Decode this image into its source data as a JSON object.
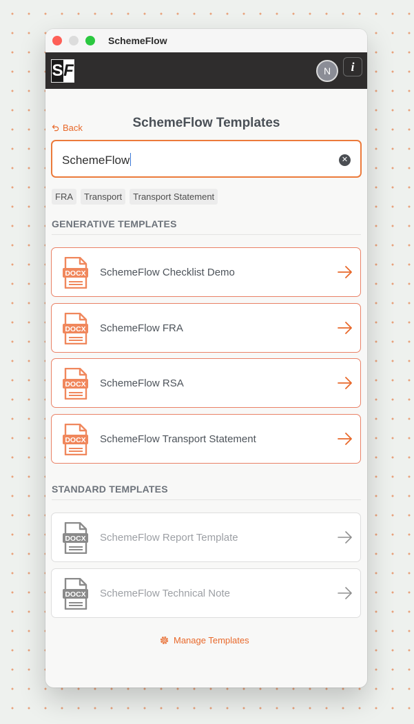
{
  "window": {
    "title": "SchemeFlow"
  },
  "appbar": {
    "logo_left": "S",
    "logo_right": "F",
    "avatar_initial": "N",
    "info_label": "i"
  },
  "nav": {
    "back_label": "Back"
  },
  "page": {
    "title": "SchemeFlow Templates"
  },
  "search": {
    "value": "SchemeFlow",
    "clear_icon": "clear-circle-icon"
  },
  "filters": [
    "FRA",
    "Transport",
    "Transport Statement"
  ],
  "generative": {
    "heading": "GENERATIVE TEMPLATES",
    "items": [
      {
        "label": "SchemeFlow Checklist Demo",
        "icon_text": "DOCX"
      },
      {
        "label": "SchemeFlow FRA",
        "icon_text": "DOCX"
      },
      {
        "label": "SchemeFlow RSA",
        "icon_text": "DOCX"
      },
      {
        "label": "SchemeFlow Transport Statement",
        "icon_text": "DOCX"
      }
    ]
  },
  "standard": {
    "heading": "STANDARD TEMPLATES",
    "items": [
      {
        "label": "SchemeFlow Report Template",
        "icon_text": "DOCX"
      },
      {
        "label": "SchemeFlow Technical Note",
        "icon_text": "DOCX"
      }
    ]
  },
  "footer": {
    "manage_label": "Manage Templates"
  },
  "colors": {
    "accent": "#e8682a",
    "gen_icon": "#f0875c",
    "std_icon": "#8a8a8a",
    "appbar": "#2f2d2d"
  }
}
